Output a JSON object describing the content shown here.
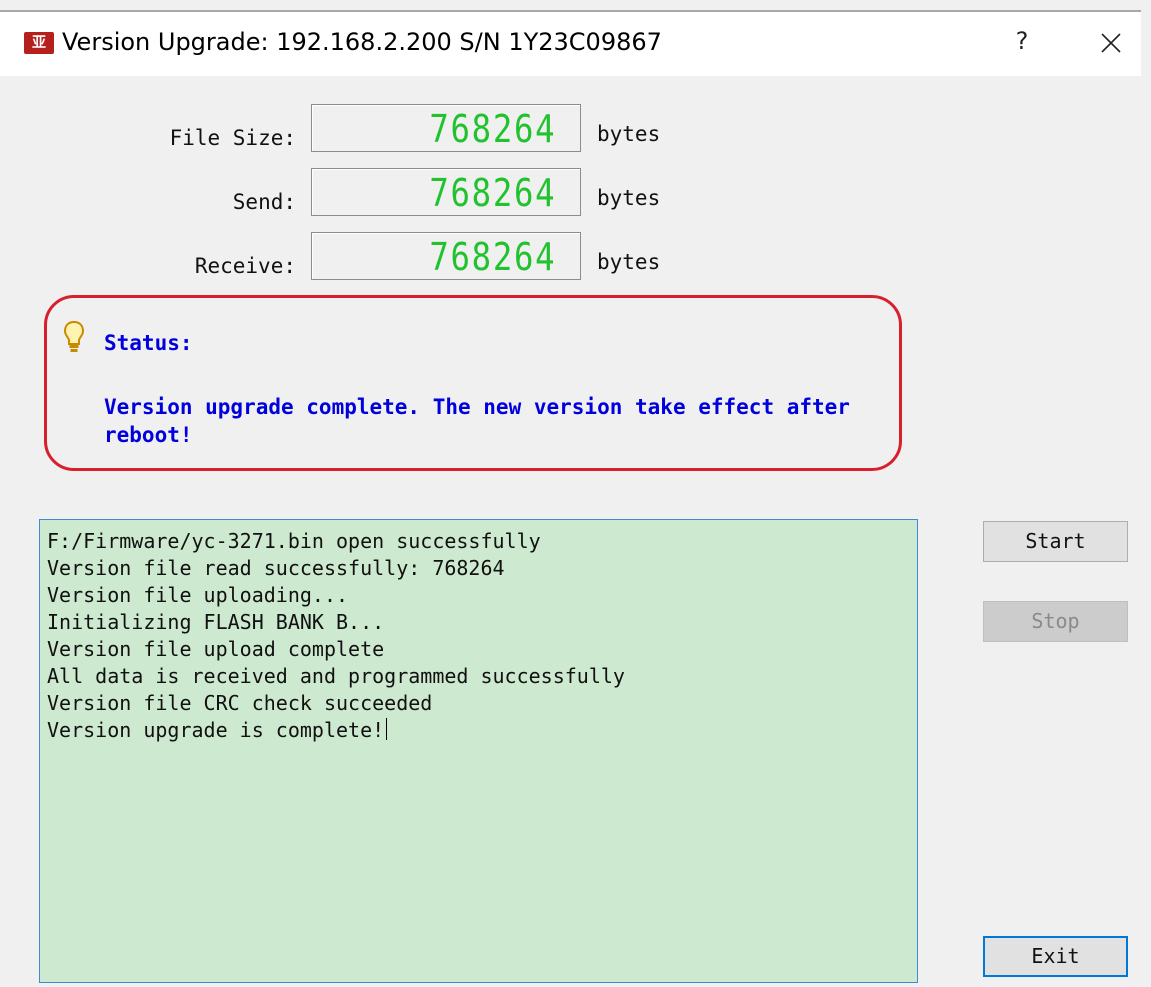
{
  "window": {
    "title": "Version Upgrade: 192.168.2.200  S/N 1Y23C09867",
    "app_icon_text": "亚",
    "help_label": "?"
  },
  "fields": [
    {
      "label": "File Size:",
      "value": "768264",
      "unit": "bytes"
    },
    {
      "label": "Send:",
      "value": "768264",
      "unit": "bytes"
    },
    {
      "label": "Receive:",
      "value": "768264",
      "unit": "bytes"
    }
  ],
  "status": {
    "title": "Status:",
    "message": "Version upgrade complete. The new version take effect after reboot!",
    "icon": "lightbulb-icon"
  },
  "log": {
    "lines": [
      "F:/Firmware/yc-3271.bin open successfully",
      "Version file read successfully: 768264",
      "Version file uploading...",
      "Initializing FLASH BANK B...",
      "Version file upload complete",
      "All data is received and programmed successfully",
      "Version file CRC check succeeded",
      "Version upgrade is complete!"
    ]
  },
  "buttons": {
    "start": "Start",
    "stop": "Stop",
    "exit": "Exit"
  },
  "colors": {
    "lcd_digits": "#22c22e",
    "status_text": "#0000dd",
    "status_border": "#d6202d",
    "log_background": "#cde9d0"
  }
}
